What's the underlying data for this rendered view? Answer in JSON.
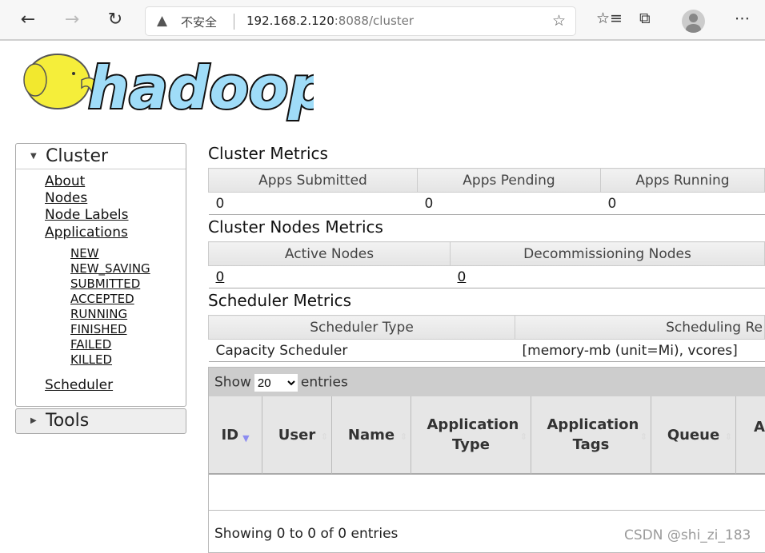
{
  "browser": {
    "security_label": "不安全",
    "url_host": "192.168.2.120",
    "url_rest": ":8088/cluster"
  },
  "logo": {
    "text": "hadoop"
  },
  "sidebar": {
    "cluster_label": "Cluster",
    "links": [
      "About",
      "Nodes",
      "Node Labels",
      "Applications"
    ],
    "app_states": [
      "NEW",
      "NEW_SAVING",
      "SUBMITTED",
      "ACCEPTED",
      "RUNNING",
      "FINISHED",
      "FAILED",
      "KILLED"
    ],
    "scheduler": "Scheduler",
    "tools_label": "Tools"
  },
  "cluster_metrics": {
    "title": "Cluster Metrics",
    "headers": [
      "Apps Submitted",
      "Apps Pending",
      "Apps Running"
    ],
    "values": [
      "0",
      "0",
      "0"
    ]
  },
  "nodes_metrics": {
    "title": "Cluster Nodes Metrics",
    "headers": [
      "Active Nodes",
      "Decommissioning Nodes"
    ],
    "values": [
      "0",
      "0"
    ]
  },
  "scheduler_metrics": {
    "title": "Scheduler Metrics",
    "headers": [
      "Scheduler Type",
      "Scheduling Re"
    ],
    "values": [
      "Capacity Scheduler",
      "[memory-mb (unit=Mi), vcores]"
    ]
  },
  "apps_table": {
    "show": "Show",
    "page_size": "20",
    "entries": "entries",
    "columns": [
      "ID",
      "User",
      "Name",
      "Application Type",
      "Application Tags",
      "Queue",
      "A"
    ],
    "info": "Showing 0 to 0 of 0 entries"
  },
  "watermark": "CSDN @shi_zi_183"
}
